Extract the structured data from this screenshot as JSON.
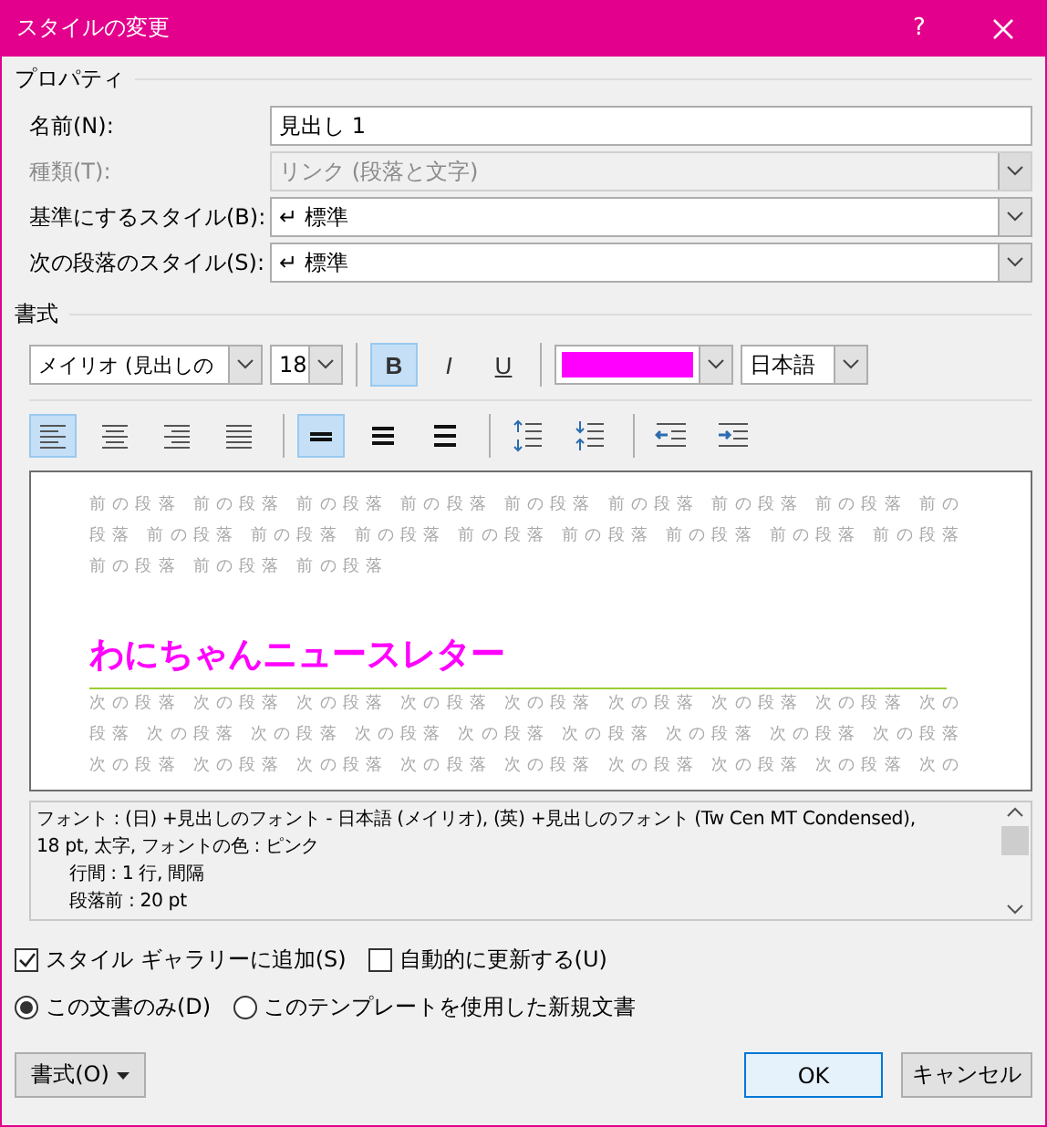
{
  "window": {
    "title": "スタイルの変更",
    "help": "?"
  },
  "properties": {
    "heading": "プロパティ",
    "fields": [
      {
        "label": "名前(N):",
        "kind": "text",
        "value": "見出し 1",
        "disabled": false
      },
      {
        "label": "種類(T):",
        "kind": "combo",
        "value": "リンク (段落と文字)",
        "disabled": true
      },
      {
        "label": "基準にするスタイル(B):",
        "kind": "combo",
        "value": "↵ 標準",
        "disabled": false
      },
      {
        "label": "次の段落のスタイル(S):",
        "kind": "combo",
        "value": "↵ 標準",
        "disabled": false
      }
    ]
  },
  "format": {
    "heading": "書式",
    "font": "メイリオ (見出しの",
    "size": "18",
    "styles": [
      {
        "kind": "bold",
        "label": "B",
        "selected": true
      },
      {
        "kind": "italic",
        "label": "I",
        "selected": false
      },
      {
        "kind": "underline",
        "label": "U",
        "selected": false
      }
    ],
    "color_picker": {
      "color": "#ff00ff"
    },
    "language": "日本語",
    "alignment": [
      {
        "kind": "left",
        "selected": true
      },
      {
        "kind": "center",
        "selected": false
      },
      {
        "kind": "right",
        "selected": false
      },
      {
        "kind": "justify",
        "selected": false
      }
    ],
    "line_spacing": [
      {
        "kind": "single",
        "selected": true
      },
      {
        "kind": "onehalf",
        "selected": false
      },
      {
        "kind": "double",
        "selected": false
      }
    ],
    "paragraph_spacing": [
      {
        "kind": "increase"
      },
      {
        "kind": "decrease"
      }
    ],
    "indent": [
      {
        "kind": "decrease"
      },
      {
        "kind": "increase"
      }
    ]
  },
  "preview": {
    "before": [
      "前の段落 前の段落 前の段落 前の段落 前の段落 前の段落 前の段落 前の段落 前の",
      "段落 前の段落 前の段落 前の段落 前の段落 前の段落 前の段落 前の段落 前の段落",
      "前の段落 前の段落 前の段落"
    ],
    "heading": "わにちゃんニュースレター",
    "after": [
      "次の段落 次の段落 次の段落 次の段落 次の段落 次の段落 次の段落 次の段落 次の",
      "段落 次の段落 次の段落 次の段落 次の段落 次の段落 次の段落 次の段落 次の段落",
      "次の段落 次の段落 次の段落 次の段落 次の段落 次の段落 次の段落 次の段落 次の"
    ]
  },
  "description": [
    {
      "text": "フォント : (日) +見出しのフォント - 日本語 (メイリオ), (英) +見出しのフォント (Tw Cen MT Condensed),",
      "indent": false
    },
    {
      "text": "18 pt, 太字, フォントの色 : ピンク",
      "indent": false
    },
    {
      "text": "行間 :  1 行, 間隔",
      "indent": true
    },
    {
      "text": "段落前 :  20 pt",
      "indent": true
    }
  ],
  "options": [
    {
      "label": "スタイル ギャラリーに追加(S)",
      "checked": true
    },
    {
      "label": "自動的に更新する(U)",
      "checked": false
    }
  ],
  "scope": [
    {
      "label": "この文書のみ(D)",
      "selected": true
    },
    {
      "label": "このテンプレートを使用した新規文書",
      "selected": false
    }
  ],
  "buttons": {
    "format": "書式(O)",
    "ok": "OK",
    "cancel": "キャンセル"
  }
}
